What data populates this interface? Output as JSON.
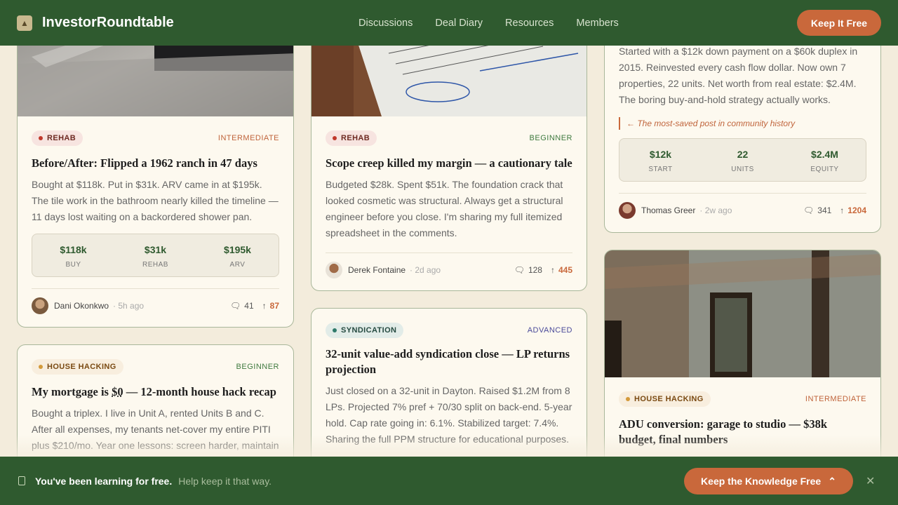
{
  "header": {
    "brand": "InvestorRoundtable",
    "nav": [
      "Discussions",
      "Deal Diary",
      "Resources",
      "Members"
    ],
    "cta": "Keep It Free"
  },
  "cards": {
    "ranch": {
      "category": "REHAB",
      "level": "INTERMEDIATE",
      "title": "Before/After: Flipped a 1962 ranch in 47 days",
      "excerpt": "Bought at $118k. Put in $31k. ARV came in at $195k. The tile work in the bathroom nearly killed the timeline — 11 days lost waiting on a backordered shower pan.",
      "stats": [
        {
          "value": "$118k",
          "label": "BUY"
        },
        {
          "value": "$31k",
          "label": "REHAB"
        },
        {
          "value": "$195k",
          "label": "ARV"
        }
      ],
      "author": "Dani Okonkwo",
      "time": "· 5h ago",
      "comments": "41",
      "votes": "87"
    },
    "scope": {
      "category": "REHAB",
      "level": "BEGINNER",
      "title": "Scope creep killed my margin — a cautionary tale",
      "excerpt": "Budgeted $28k. Spent $51k. The foundation crack that looked cosmetic was structural. Always get a structural engineer before you close. I'm sharing my full itemized spreadsheet in the comments.",
      "author": "Derek Fontaine",
      "time": "· 2d ago",
      "comments": "128",
      "votes": "445"
    },
    "duplex": {
      "excerpt": "Started with a $12k down payment on a $60k duplex in 2015. Reinvested every cash flow dollar. Now own 7 properties, 22 units. Net worth from real estate: $2.4M. The boring buy-and-hold strategy actually works.",
      "quote": "← The most-saved post in community history",
      "stats": [
        {
          "value": "$12k",
          "label": "START"
        },
        {
          "value": "22",
          "label": "UNITS"
        },
        {
          "value": "$2.4M",
          "label": "EQUITY"
        }
      ],
      "author": "Thomas Greer",
      "time": "· 2w ago",
      "comments": "341",
      "votes": "1204"
    },
    "hack": {
      "category": "HOUSE HACKING",
      "level": "BEGINNER",
      "title_pre": "My mortgage is ",
      "title_em": "$0",
      "title_post": " — 12-month house hack recap",
      "excerpt": "Bought a triplex. I live in Unit A, rented Units B and C. After all expenses, my tenants net-cover my entire PITI plus $210/mo. Year one lessons: screen harder, maintain"
    },
    "synd": {
      "category": "SYNDICATION",
      "level": "ADVANCED",
      "title": "32-unit value-add syndication close — LP returns projection",
      "excerpt": "Just closed on a 32-unit in Dayton. Raised $1.2M from 8 LPs. Projected 7% pref + 70/30 split on back-end. 5-year hold. Cap rate going in: 6.1%. Stabilized target: 7.4%. Sharing the full PPM structure for educational purposes."
    },
    "adu": {
      "category": "HOUSE HACKING",
      "level": "INTERMEDIATE",
      "title": "ADU conversion: garage to studio — $38k budget, final numbers"
    }
  },
  "banner": {
    "strong": "You've been learning for free.",
    "sub": "Help keep it that way.",
    "button": "Keep the Knowledge Free",
    "button_icon": "chevron-up-icon",
    "close_icon": "close-icon"
  },
  "colors": {
    "brand_green": "#2f5a2f",
    "accent_orange": "#c9683b",
    "page_bg": "#f3ecdc"
  }
}
